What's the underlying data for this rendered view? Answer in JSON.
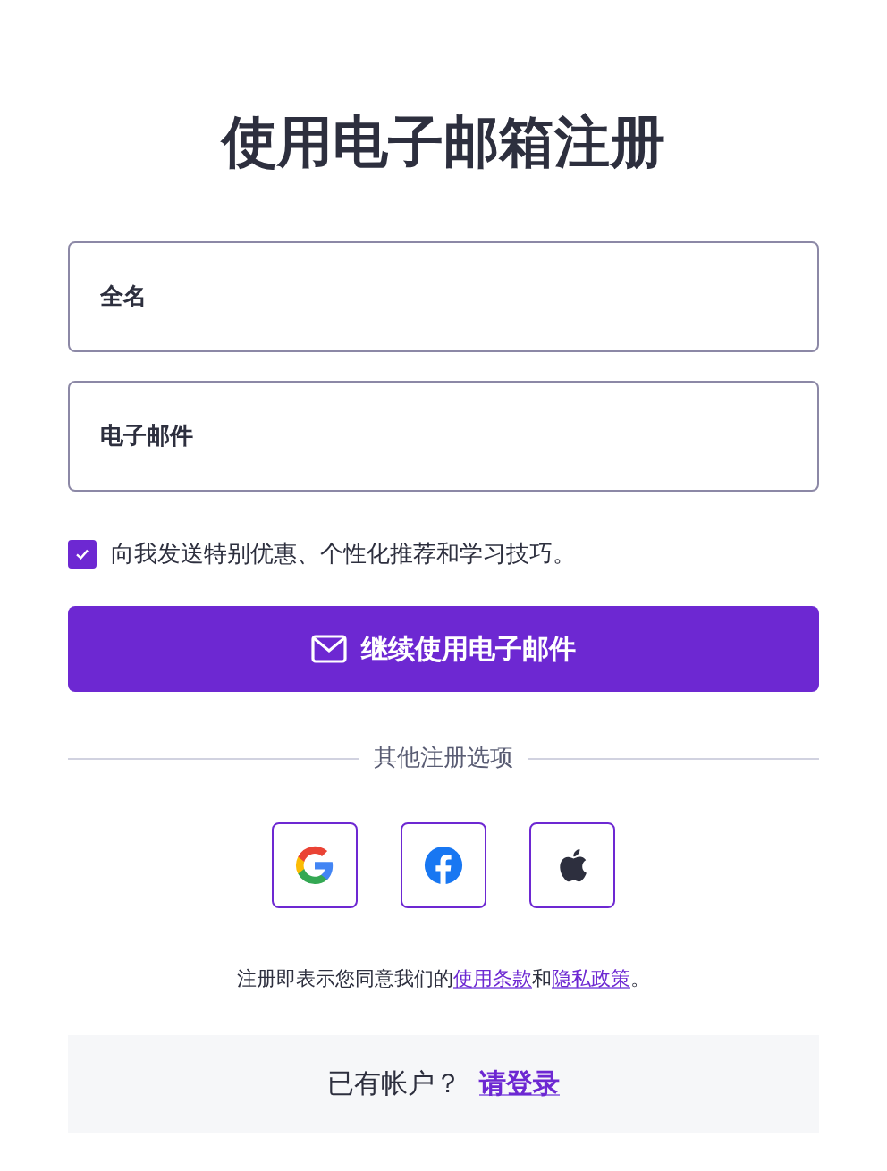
{
  "title": "使用电子邮箱注册",
  "fields": [
    {
      "placeholder": "全名"
    },
    {
      "placeholder": "电子邮件"
    }
  ],
  "opt_in": {
    "label": "向我发送特别优惠、个性化推荐和学习技巧。",
    "checked": true
  },
  "submit_button": "继续使用电子邮件",
  "divider_label": "其他注册选项",
  "social_buttons": [
    {
      "kind": "google"
    },
    {
      "kind": "facebook"
    },
    {
      "kind": "apple"
    }
  ],
  "terms": {
    "before": "注册即表示您同意我们的",
    "link_1": "使用条款",
    "middle": "和",
    "link_2": "隐私政策",
    "after": "。"
  },
  "login_prompt": {
    "text": "已有帐户？",
    "link": "请登录"
  }
}
